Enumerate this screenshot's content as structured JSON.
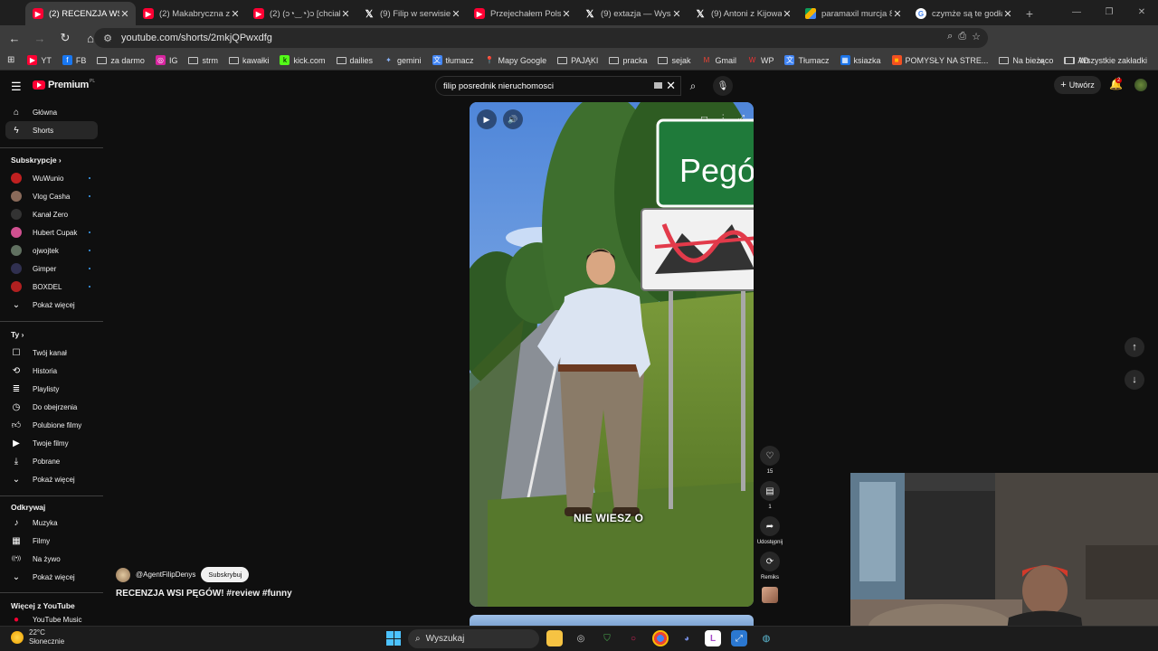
{
  "browser": {
    "tabs": [
      {
        "title": "(2) RECENZJA WSI PĘ",
        "icon": "yt",
        "active": true
      },
      {
        "title": "(2) Makabryczna zbro",
        "icon": "yt",
        "active": false
      },
      {
        "title": "(2) (ɔ◔‿◔)ɔ [chciał",
        "icon": "yt",
        "active": false
      },
      {
        "title": "(9) Filip w serwisie X:",
        "icon": "x",
        "active": false
      },
      {
        "title": "Przejechałem Polskę",
        "icon": "yt",
        "active": false
      },
      {
        "title": "(9) extazja — Wyszuk",
        "icon": "x",
        "active": false
      },
      {
        "title": "(9) Antoni z Kijowa w",
        "icon": "x",
        "active": false
      },
      {
        "title": "paramaxil murcja 80",
        "icon": "drive",
        "active": false
      },
      {
        "title": "czymże są te godła w",
        "icon": "g",
        "active": false
      }
    ],
    "url": "youtube.com/shorts/2mkjQPwxdfg",
    "bookmarks": [
      {
        "label": "YT",
        "icon": "yt-icon"
      },
      {
        "label": "FB",
        "icon": "facebook-icon"
      },
      {
        "label": "za darmo",
        "icon": "folder-icon"
      },
      {
        "label": "IG",
        "icon": "instagram-icon"
      },
      {
        "label": "strm",
        "icon": "folder-icon"
      },
      {
        "label": "kawałki",
        "icon": "folder-icon"
      },
      {
        "label": "kick.com",
        "icon": "kick-icon"
      },
      {
        "label": "dailies",
        "icon": "folder-icon"
      },
      {
        "label": "gemini",
        "icon": "gemini-icon"
      },
      {
        "label": "tłumacz",
        "icon": "translate-icon"
      },
      {
        "label": "Mapy Google",
        "icon": "maps-icon"
      },
      {
        "label": "PAJĄKI",
        "icon": "folder-icon"
      },
      {
        "label": "pracka",
        "icon": "folder-icon"
      },
      {
        "label": "sejak",
        "icon": "folder-icon"
      },
      {
        "label": "Gmail",
        "icon": "gmail-icon"
      },
      {
        "label": "WP",
        "icon": "wp-icon"
      },
      {
        "label": "Tłumacz",
        "icon": "translate-icon"
      },
      {
        "label": "ksiazka",
        "icon": "grid-icon"
      },
      {
        "label": "POMYSŁY NA STRE...",
        "icon": "ms-icon"
      },
      {
        "label": "Na bieżąco",
        "icon": "folder-icon"
      },
      {
        "label": "AD",
        "icon": "folder-icon"
      }
    ],
    "bookmarks_more": "»",
    "all_bookmarks": "Wszystkie zakładki"
  },
  "yt": {
    "logo_text": "Premium",
    "logo_country": "PL",
    "search_value": "filip posrednik nieruchomosci",
    "create_label": "Utwórz",
    "notif_count": "2",
    "sidebar": {
      "main": [
        {
          "label": "Główna",
          "icon": "home-icon"
        },
        {
          "label": "Shorts",
          "icon": "shorts-icon"
        }
      ],
      "subs_header": "Subskrypcje",
      "subs": [
        {
          "label": "WuWunio",
          "color": "#c02020"
        },
        {
          "label": "Vlog Casha",
          "color": "#8a6a5a"
        },
        {
          "label": "Kanał Zero",
          "color": "#333333"
        },
        {
          "label": "Hubert Cupak",
          "color": "#d05090"
        },
        {
          "label": "ojwojtek",
          "color": "#607060"
        },
        {
          "label": "Gimper",
          "color": "#303050"
        },
        {
          "label": "BOXDEL",
          "color": "#b02020"
        }
      ],
      "show_more": "Pokaż więcej",
      "you_header": "Ty",
      "you": [
        {
          "label": "Twój kanał",
          "icon": "channel-icon"
        },
        {
          "label": "Historia",
          "icon": "history-icon"
        },
        {
          "label": "Playlisty",
          "icon": "playlist-icon"
        },
        {
          "label": "Do obejrzenia",
          "icon": "watch-later-icon"
        },
        {
          "label": "Polubione filmy",
          "icon": "like-icon"
        },
        {
          "label": "Twoje filmy",
          "icon": "your-videos-icon"
        },
        {
          "label": "Pobrane",
          "icon": "download-icon"
        },
        {
          "label": "Pokaż więcej",
          "icon": "chevron-down-icon"
        }
      ],
      "explore_header": "Odkrywaj",
      "explore": [
        {
          "label": "Muzyka",
          "icon": "music-icon"
        },
        {
          "label": "Filmy",
          "icon": "film-icon"
        },
        {
          "label": "Na żywo",
          "icon": "live-icon"
        },
        {
          "label": "Pokaż więcej",
          "icon": "chevron-down-icon"
        }
      ],
      "more_header": "Więcej z YouTube",
      "yt_music": "YouTube Music"
    },
    "short": {
      "subtitle": "NIE WIESZ O",
      "sign_text": "Pegów",
      "channel": "@AgentFilipDenys",
      "subscribe": "Subskrybuj",
      "title": "RECENZJA WSI PĘGÓW! #review #funny",
      "likes": "15",
      "comments": "1",
      "share": "Udostępnij",
      "remix": "Remiks"
    }
  },
  "taskbar": {
    "temp": "22°C",
    "weather": "Słonecznie",
    "search_placeholder": "Wyszukaj"
  }
}
